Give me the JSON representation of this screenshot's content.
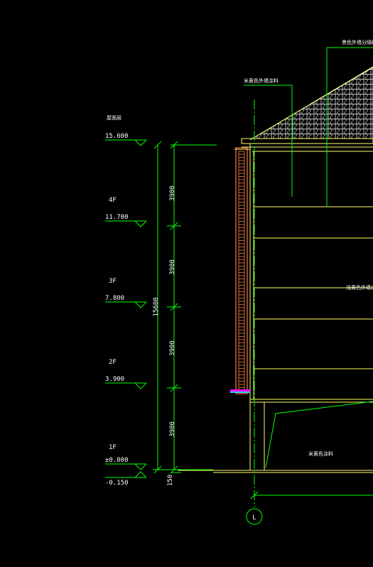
{
  "levels": [
    {
      "name": "屋面层",
      "elevation": "15.600"
    },
    {
      "name": "4F",
      "elevation": "11.700"
    },
    {
      "name": "3F",
      "elevation": "7.800"
    },
    {
      "name": "2F",
      "elevation": "3.900"
    },
    {
      "name": "1F",
      "elevation": "±0.000"
    },
    {
      "name": "",
      "elevation": "-0.150"
    }
  ],
  "dimensions": {
    "floor_heights": [
      "3900",
      "3900",
      "3900",
      "3900"
    ],
    "base_offset": "150",
    "total": "15600"
  },
  "annotations": {
    "roof_tile": "黑色外墙分隔砖",
    "wall_paint": "米黄色外墙涂料",
    "mid_wall": "浅黄色外墙涂料外墙",
    "base_area": "米黄色涂料"
  },
  "grid_axis": "L",
  "colors": {
    "background": "#000000",
    "text": "#ffffff",
    "dimension": "#00ff00",
    "wall": "#ffff66",
    "railing": "#ff7f3f",
    "axis": "#00ff00"
  }
}
